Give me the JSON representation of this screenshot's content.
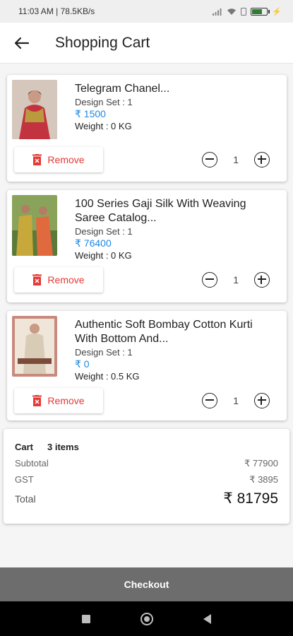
{
  "status_bar": {
    "time_speed": "11:03 AM | 78.5KB/s",
    "battery_level": 0.7
  },
  "header": {
    "title": "Shopping Cart",
    "back_icon": "arrow-left-icon"
  },
  "items": [
    {
      "name": "Telegram Chanel...",
      "design_set": "Design Set : 1",
      "price": "₹ 1500",
      "weight": "Weight : 0 KG",
      "remove_label": "Remove",
      "quantity": "1"
    },
    {
      "name": "100 Series Gaji Silk With Weaving Saree Catalog...",
      "design_set": "Design Set : 1",
      "price": "₹ 76400",
      "weight": "Weight : 0 KG",
      "remove_label": "Remove",
      "quantity": "1"
    },
    {
      "name": "Authentic Soft Bombay Cotton Kurti With Bottom And...",
      "design_set": "Design Set : 1",
      "price": "₹ 0",
      "weight": "Weight : 0.5 KG",
      "remove_label": "Remove",
      "quantity": "1"
    }
  ],
  "summary": {
    "cart_label": "Cart",
    "items_count": "3 items",
    "subtotal_label": "Subtotal",
    "subtotal_value": "₹ 77900",
    "gst_label": "GST",
    "gst_value": "₹ 3895",
    "total_label": "Total",
    "total_value": "₹ 81795"
  },
  "checkout_label": "Checkout",
  "colors": {
    "price": "#1e88e5",
    "remove": "#e53935",
    "checkout_bg": "#6d6d6d"
  }
}
